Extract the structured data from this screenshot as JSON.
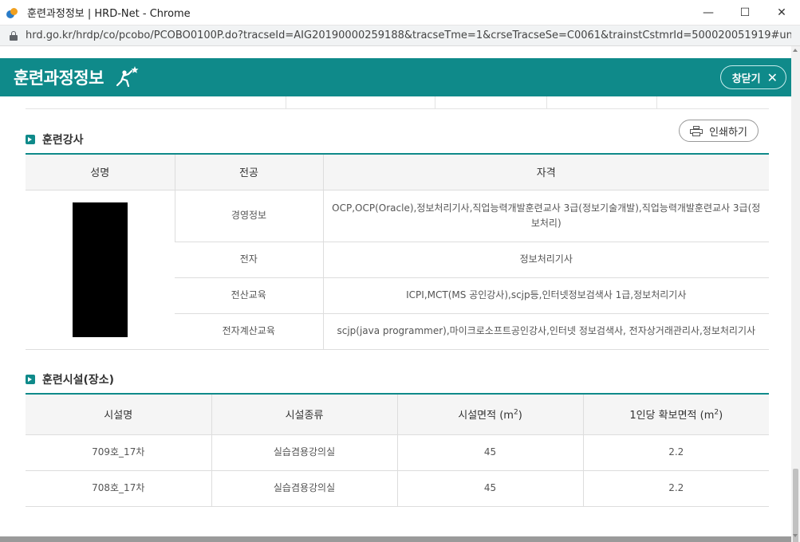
{
  "window": {
    "title": "훈련과정정보 | HRD-Net - Chrome",
    "minimize": "—",
    "maximize": "☐",
    "close": "✕"
  },
  "address": {
    "url": "hrd.go.kr/hrdp/co/pcobo/PCOBO0100P.do?tracseId=AIG20190000259188&tracseTme=1&crseTracseSe=C0061&trainstCstmrId=500020051919#und..."
  },
  "header": {
    "title": "훈련과정정보",
    "close_label": "창닫기",
    "close_x": "✕"
  },
  "print_label": "인쇄하기",
  "instructors": {
    "section_title": "훈련강사",
    "columns": [
      "성명",
      "전공",
      "자격"
    ],
    "rows": [
      {
        "major": "경영정보",
        "qualification": "OCP,OCP(Oracle),정보처리기사,직업능력개발훈련교사 3급(정보기술개발),직업능력개발훈련교사 3급(정보처리)"
      },
      {
        "major": "전자",
        "qualification": "정보처리기사"
      },
      {
        "major": "전산교육",
        "qualification": "ICPI,MCT(MS 공인강사),scjp등,인터넷정보검색사 1급,정보처리기사"
      },
      {
        "major": "전자계산교육",
        "qualification": "scjp(java programmer),마이크로소프트공인강사,인터넷 정보검색사, 전자상거래관리사,정보처리기사"
      }
    ]
  },
  "facilities": {
    "section_title": "훈련시설(장소)",
    "columns": [
      "시설명",
      "시설종류",
      "시설면적 (m",
      "1인당 확보면적 (m"
    ],
    "unit_exp": "2",
    "unit_close": ")",
    "rows": [
      {
        "name": "709호_17차",
        "type": "실습겸용강의실",
        "area": "45",
        "per_person": "2.2"
      },
      {
        "name": "708호_17차",
        "type": "실습겸용강의실",
        "area": "45",
        "per_person": "2.2"
      }
    ]
  },
  "colors": {
    "accent": "#0f8a8a"
  }
}
